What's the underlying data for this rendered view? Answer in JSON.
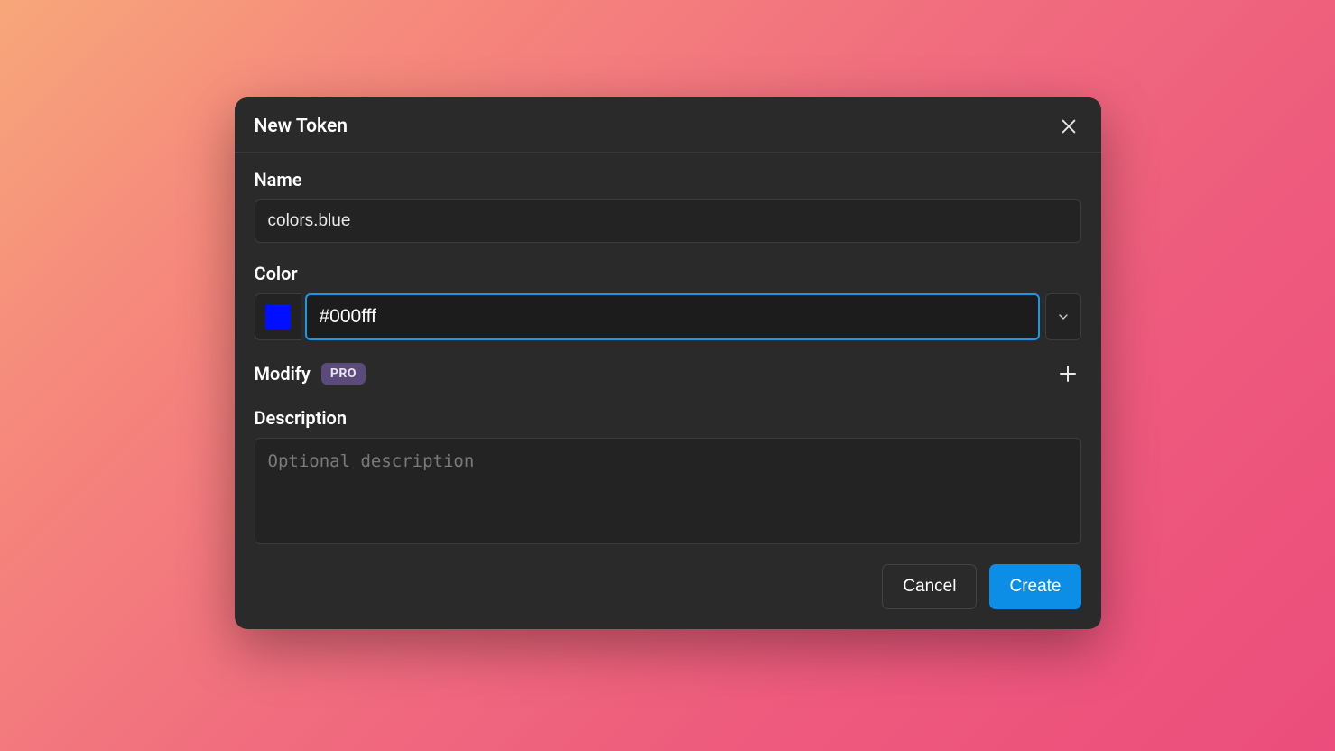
{
  "dialog": {
    "title": "New Token",
    "name": {
      "label": "Name",
      "value": "colors.blue"
    },
    "color": {
      "label": "Color",
      "value": "#000fff",
      "swatch_color": "#000fff"
    },
    "modify": {
      "label": "Modify",
      "badge": "PRO"
    },
    "description": {
      "label": "Description",
      "placeholder": "Optional description",
      "value": ""
    },
    "buttons": {
      "cancel": "Cancel",
      "create": "Create"
    }
  }
}
